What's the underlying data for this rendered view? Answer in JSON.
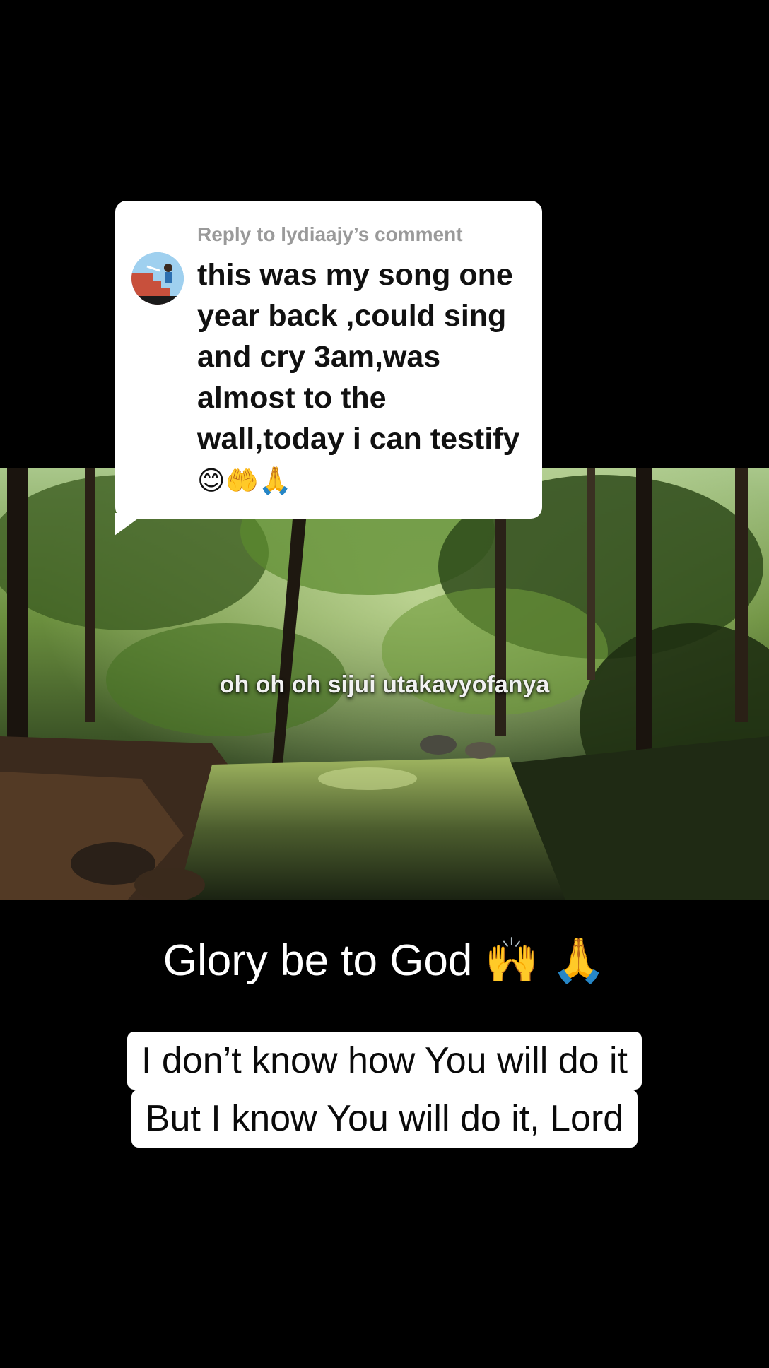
{
  "reply": {
    "header": "Reply to lydiaajy’s comment",
    "text": "this was my song one year back ,could sing and cry 3am,was almost to the wall,today i can testify",
    "emojis": "😊🤲🙏"
  },
  "video": {
    "caption": "oh oh oh sijui utakavyofanya"
  },
  "headline": {
    "text": "Glory be to God 🙌 🙏"
  },
  "lyrics": {
    "line1": "I don’t know how You will do it",
    "line2": "But I know You will do it, Lord"
  },
  "colors": {
    "background": "#000000",
    "card": "#ffffff",
    "reply_header": "#9a9a9a",
    "forest_dark": "#1c2414",
    "forest_green": "#4d7a2a"
  }
}
